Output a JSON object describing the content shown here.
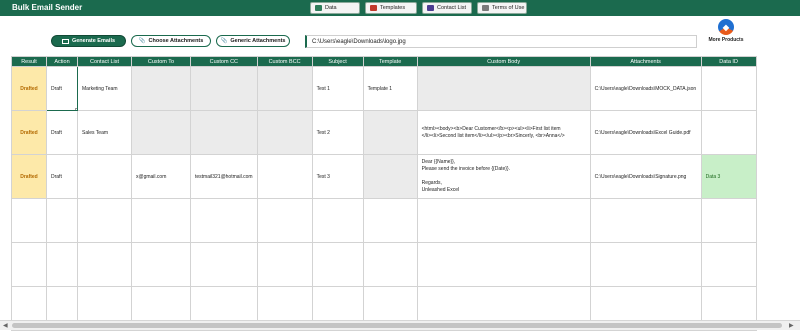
{
  "app": {
    "title": "Bulk Email Sender"
  },
  "nav": [
    {
      "label": "Data",
      "icon": "table-icon",
      "color": "#2e7d5b"
    },
    {
      "label": "Templates",
      "icon": "template-icon",
      "color": "#c0392b"
    },
    {
      "label": "Contact List",
      "icon": "contacts-icon",
      "color": "#4b3c91"
    },
    {
      "label": "Terms of Use",
      "icon": "document-icon",
      "color": "#7a7a7a"
    }
  ],
  "actions": {
    "generate_label": "Generate Emails",
    "choose_attachments_label": "Choose Attachments",
    "generic_attachments_label": "Generic Attachments",
    "path_value": "C:\\Users\\eagle\\Downloads\\logo.jpg",
    "more_products_label": "More Products"
  },
  "table": {
    "headers": [
      "Result",
      "Action",
      "Contact List",
      "Custom To",
      "Custom CC",
      "Custom BCC",
      "Subject",
      "Template",
      "Custom Body",
      "Attachments",
      "Data ID"
    ],
    "rows": [
      [
        "Drafted",
        "Draft",
        "Marketing Team",
        "",
        "",
        "",
        "Test 1",
        "Template 1",
        "",
        "C:\\Users\\eagle\\Downloads\\MOCK_DATA.json",
        ""
      ],
      [
        "Drafted",
        "Draft",
        "Sales Team",
        "",
        "",
        "",
        "Test 2",
        "",
        "<html><body><b>Dear Customer</b><p><ul><li>First list item\n</li><li>Second list item</li></ul></p><br>Sincerly, <br>Anna</>",
        "C:\\Users\\eagle\\Downloads\\Excel Guide.pdf",
        ""
      ],
      [
        "Drafted",
        "Draft",
        "",
        "x@gmail.com",
        "testmail321@hotmail.com",
        "",
        "Test 3",
        "",
        "Dear {{Name}},\nPlease send the invoice before {{Date}}.\n\nRegards,\nUnleashed Excel",
        "C:\\Users\\eagle\\Downloads\\Signature.png",
        "Data 3"
      ],
      [
        "",
        "",
        "",
        "",
        "",
        "",
        "",
        "",
        "",
        "",
        ""
      ],
      [
        "",
        "",
        "",
        "",
        "",
        "",
        "",
        "",
        "",
        "",
        ""
      ],
      [
        "",
        "",
        "",
        "",
        "",
        "",
        "",
        "",
        "",
        "",
        ""
      ]
    ]
  },
  "colors": {
    "brand": "#1b6a4e",
    "drafted_bg": "#fde9a9",
    "data_id_bg": "#c8efc8"
  }
}
